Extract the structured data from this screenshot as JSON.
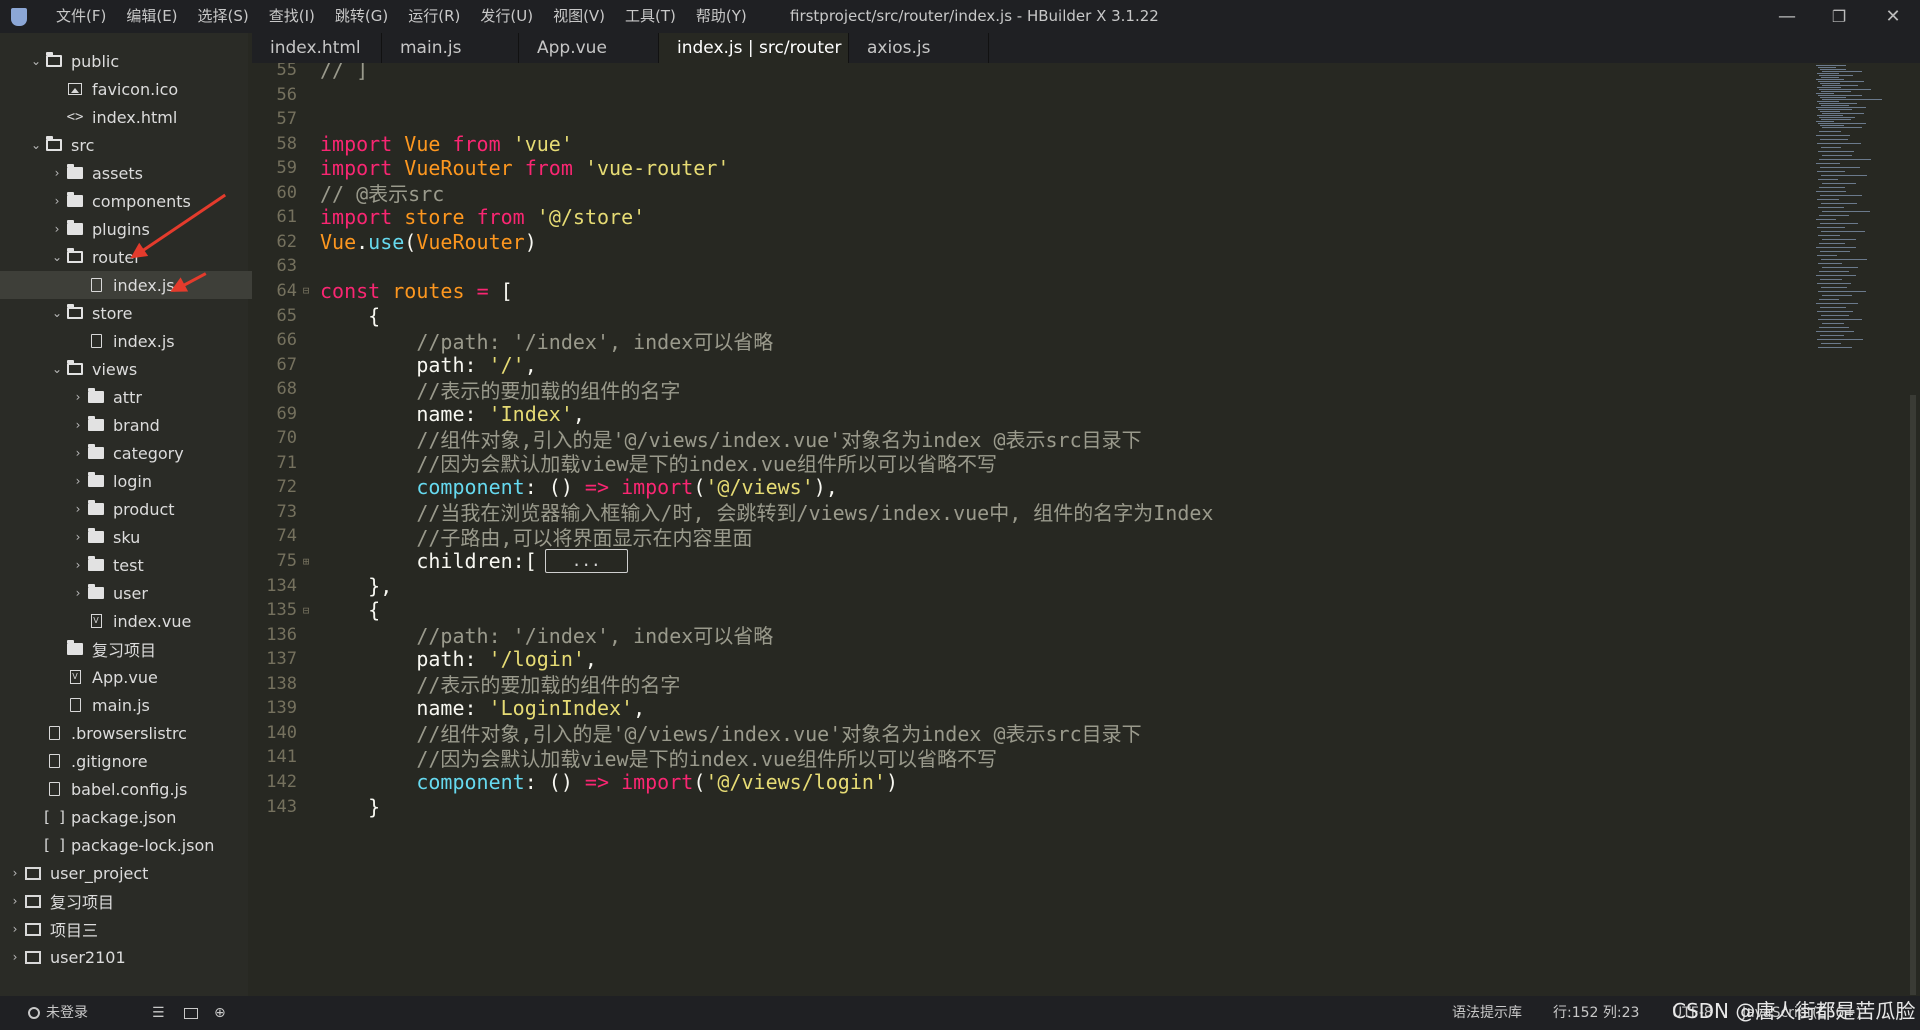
{
  "window": {
    "title": "firstproject/src/router/index.js - HBuilder X 3.1.22",
    "menu": [
      "文件(F)",
      "编辑(E)",
      "选择(S)",
      "查找(I)",
      "跳转(G)",
      "运行(R)",
      "发行(U)",
      "视图(V)",
      "工具(T)",
      "帮助(Y)"
    ],
    "controls": {
      "minimize": "—",
      "maximize": "❐",
      "close": "✕"
    }
  },
  "tabs": [
    "index.html",
    "main.js",
    "App.vue",
    "index.js | src/router",
    "axios.js"
  ],
  "active_tab": 3,
  "tree": [
    {
      "label": "public",
      "icon": "folder-open-icon",
      "arrow": "⌄"
    },
    {
      "label": "favicon.ico",
      "icon": "image-file-icon",
      "arrow": ""
    },
    {
      "label": "index.html",
      "icon": "html-file-icon",
      "arrow": ""
    },
    {
      "label": "src",
      "icon": "folder-open-icon",
      "arrow": "⌄"
    },
    {
      "label": "assets",
      "icon": "folder-icon",
      "arrow": "›"
    },
    {
      "label": "components",
      "icon": "folder-icon",
      "arrow": "›"
    },
    {
      "label": "plugins",
      "icon": "folder-icon",
      "arrow": "›"
    },
    {
      "label": "router",
      "icon": "folder-open-icon",
      "arrow": "⌄"
    },
    {
      "label": "index.js",
      "icon": "js-file-icon",
      "arrow": ""
    },
    {
      "label": "store",
      "icon": "folder-open-icon",
      "arrow": "⌄"
    },
    {
      "label": "index.js",
      "icon": "js-file-icon",
      "arrow": ""
    },
    {
      "label": "views",
      "icon": "folder-open-icon",
      "arrow": "⌄"
    },
    {
      "label": "attr",
      "icon": "folder-icon",
      "arrow": "›"
    },
    {
      "label": "brand",
      "icon": "folder-icon",
      "arrow": "›"
    },
    {
      "label": "category",
      "icon": "folder-icon",
      "arrow": "›"
    },
    {
      "label": "login",
      "icon": "folder-icon",
      "arrow": "›"
    },
    {
      "label": "product",
      "icon": "folder-icon",
      "arrow": "›"
    },
    {
      "label": "sku",
      "icon": "folder-icon",
      "arrow": "›"
    },
    {
      "label": "test",
      "icon": "folder-icon",
      "arrow": "›"
    },
    {
      "label": "user",
      "icon": "folder-icon",
      "arrow": "›"
    },
    {
      "label": "index.vue",
      "icon": "vue-file-icon",
      "arrow": ""
    },
    {
      "label": "复习项目",
      "icon": "folder-icon",
      "arrow": ""
    },
    {
      "label": "App.vue",
      "icon": "vue-file-icon",
      "arrow": ""
    },
    {
      "label": "main.js",
      "icon": "js-file-icon",
      "arrow": ""
    },
    {
      "label": ".browserslistrc",
      "icon": "file-icon",
      "arrow": ""
    },
    {
      "label": ".gitignore",
      "icon": "file-icon",
      "arrow": ""
    },
    {
      "label": "babel.config.js",
      "icon": "js-file-icon",
      "arrow": ""
    },
    {
      "label": "package.json",
      "icon": "json-file-icon",
      "arrow": ""
    },
    {
      "label": "package-lock.json",
      "icon": "json-file-icon",
      "arrow": ""
    },
    {
      "label": "user_project",
      "icon": "project-icon",
      "arrow": "›"
    },
    {
      "label": "复习项目",
      "icon": "project-icon",
      "arrow": "›"
    },
    {
      "label": "项目三",
      "icon": "project-icon",
      "arrow": "›"
    },
    {
      "label": "user2101",
      "icon": "project-icon",
      "arrow": "›"
    }
  ],
  "selected_tree_item": 8,
  "code_lines": [
    {
      "num": "55",
      "fold": "",
      "code": "// ]",
      "kind": "cmt"
    },
    {
      "num": "56",
      "fold": "",
      "code": ""
    },
    {
      "num": "57",
      "fold": "",
      "code": ""
    },
    {
      "num": "58",
      "fold": "",
      "code": "import Vue from 'vue'"
    },
    {
      "num": "59",
      "fold": "",
      "code": "import VueRouter from 'vue-router'"
    },
    {
      "num": "60",
      "fold": "",
      "code": "// @表示src",
      "kind": "cmt"
    },
    {
      "num": "61",
      "fold": "",
      "code": "import store from '@/store'"
    },
    {
      "num": "62",
      "fold": "",
      "code": "Vue.use(VueRouter)"
    },
    {
      "num": "63",
      "fold": "",
      "code": ""
    },
    {
      "num": "64",
      "fold": "⊟",
      "code": "const routes = ["
    },
    {
      "num": "65",
      "fold": "",
      "code": "    {"
    },
    {
      "num": "66",
      "fold": "",
      "code": "        //path: '/index', index可以省略",
      "kind": "cmt"
    },
    {
      "num": "67",
      "fold": "",
      "code": "        path: '/',"
    },
    {
      "num": "68",
      "fold": "",
      "code": "        //表示的要加载的组件的名字",
      "kind": "cmt"
    },
    {
      "num": "69",
      "fold": "",
      "code": "        name: 'Index',"
    },
    {
      "num": "70",
      "fold": "",
      "code": "        //组件对象,引入的是'@/views/index.vue'对象名为index @表示src目录下",
      "kind": "cmt"
    },
    {
      "num": "71",
      "fold": "",
      "code": "        //因为会默认加载view是下的index.vue组件所以可以省略不写",
      "kind": "cmt"
    },
    {
      "num": "72",
      "fold": "",
      "code": "        component: () => import('@/views'),"
    },
    {
      "num": "73",
      "fold": "",
      "code": "        //当我在浏览器输入框输入/时, 会跳转到/views/index.vue中, 组件的名字为Index",
      "kind": "cmt"
    },
    {
      "num": "74",
      "fold": "",
      "code": "        //子路由,可以将界面显示在内容里面",
      "kind": "cmt"
    },
    {
      "num": "75",
      "fold": "⊞",
      "code": "        children:[",
      "folded": "..."
    },
    {
      "num": "134",
      "fold": "",
      "code": "    },"
    },
    {
      "num": "135",
      "fold": "⊟",
      "code": "    {"
    },
    {
      "num": "136",
      "fold": "",
      "code": "        //path: '/index', index可以省略",
      "kind": "cmt"
    },
    {
      "num": "137",
      "fold": "",
      "code": "        path: '/login',"
    },
    {
      "num": "138",
      "fold": "",
      "code": "        //表示的要加载的组件的名字",
      "kind": "cmt"
    },
    {
      "num": "139",
      "fold": "",
      "code": "        name: 'LoginIndex',"
    },
    {
      "num": "140",
      "fold": "",
      "code": "        //组件对象,引入的是'@/views/index.vue'对象名为index @表示src目录下",
      "kind": "cmt"
    },
    {
      "num": "141",
      "fold": "",
      "code": "        //因为会默认加载view是下的index.vue组件所以可以省略不写",
      "kind": "cmt"
    },
    {
      "num": "142",
      "fold": "",
      "code": "        component: () => import('@/views/login')"
    },
    {
      "num": "143",
      "fold": "",
      "code": "    }"
    }
  ],
  "status": {
    "login": "未登录",
    "syntax_hint": "语法提示库",
    "position": "行:152  列:23",
    "encoding": "UTF-8",
    "language": "JavaScript(ES6+)",
    "watermark": "CSDN @唐人街都是苦瓜脸"
  },
  "colors": {
    "editor_bg": "#272822",
    "keyword": "#f92672",
    "string": "#e6db74",
    "comment": "#9a9a8c",
    "variable": "#fd971f",
    "property": "#66d9ef",
    "annotation_arrow": "#e43b2c"
  }
}
